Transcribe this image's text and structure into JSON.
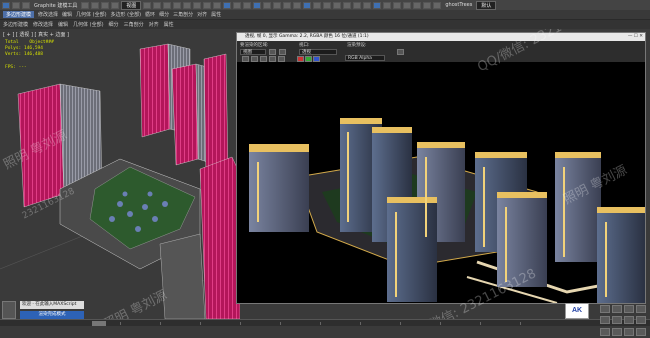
{
  "toolbar": {
    "graphite_label": "Graphite 建模工具",
    "view_dropdown": "视图",
    "workspace_label": "ghostTrees",
    "workspace_extra": "默认"
  },
  "ribbon": {
    "tabs": [
      "多边形建模",
      "修改选择",
      "编辑",
      "几何体 (全部)",
      "多边形 (全部)",
      "循环",
      "细分",
      "三角剖分",
      "对齐",
      "属性"
    ]
  },
  "menu": {
    "items": [
      "多边形建模",
      "修改选择",
      "编辑",
      "几何体 (全部)",
      "细分",
      "三角剖分",
      "对齐",
      "属性"
    ]
  },
  "viewport": {
    "label": "[ + ] [ 透视 ] [ 真实 + 边面 ]",
    "stats": {
      "total_label": "Total",
      "total_value": "Object###",
      "polys_label": "Polys:",
      "polys_value": "146,594",
      "verts_label": "Verts:",
      "verts_value": "146,488"
    },
    "fps_label": "FPS:",
    "fps_value": "---"
  },
  "render_window": {
    "title": "透视, 帧 0, 显示 Gamma: 2.2, RGBA 颜色 16 位/通道 (1:1)",
    "area_label": "要渲染的区域:",
    "area_value": "视图",
    "viewport_label": "视口:",
    "viewport_value": "透视",
    "preset_label": "渲染预设:",
    "channel_value": "RGB Alpha"
  },
  "status": {
    "input_text": "欢迎 · 在此输入MAXScript",
    "hint": "渲染完成模式"
  },
  "logo": {
    "text": "AK"
  },
  "watermarks": [
    "QQ/微信: 2321163128",
    "照明 粤刘源",
    "2321163128",
    "照明 粤刘源",
    "QQ/微信: 2321163128",
    "照明 粤刘源"
  ]
}
